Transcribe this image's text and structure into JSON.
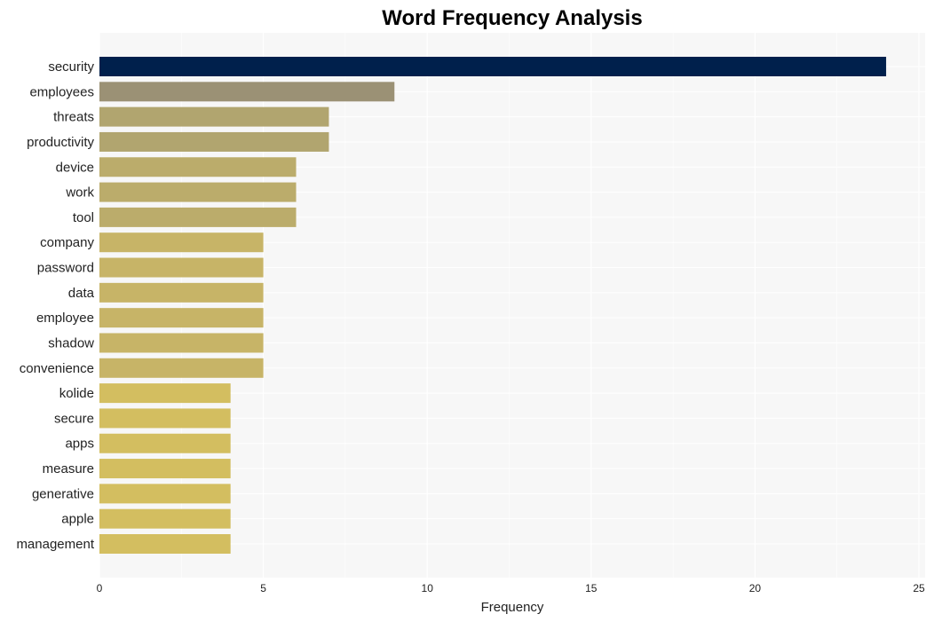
{
  "chart_data": {
    "type": "bar",
    "orientation": "horizontal",
    "title": "Word Frequency Analysis",
    "xlabel": "Frequency",
    "ylabel": "",
    "xlim": [
      0,
      25
    ],
    "xticks": [
      0,
      5,
      10,
      15,
      20,
      25
    ],
    "grid": true,
    "categories": [
      "security",
      "employees",
      "threats",
      "productivity",
      "device",
      "work",
      "tool",
      "company",
      "password",
      "data",
      "employee",
      "shadow",
      "convenience",
      "kolide",
      "secure",
      "apps",
      "measure",
      "generative",
      "apple",
      "management"
    ],
    "values": [
      24,
      9,
      7,
      7,
      6,
      6,
      6,
      5,
      5,
      5,
      5,
      5,
      5,
      4,
      4,
      4,
      4,
      4,
      4,
      4
    ],
    "colors": [
      "#00204c",
      "#9b9175",
      "#b1a56f",
      "#b1a56f",
      "#bbac6b",
      "#bbac6b",
      "#bbac6b",
      "#c7b467",
      "#c7b467",
      "#c7b467",
      "#c7b467",
      "#c7b467",
      "#c7b467",
      "#d3be60",
      "#d3be60",
      "#d3be60",
      "#d3be60",
      "#d3be60",
      "#d3be60",
      "#d3be60"
    ]
  },
  "style": {
    "plot_background": "#f7f7f7",
    "grid_color": "#ffffff"
  }
}
